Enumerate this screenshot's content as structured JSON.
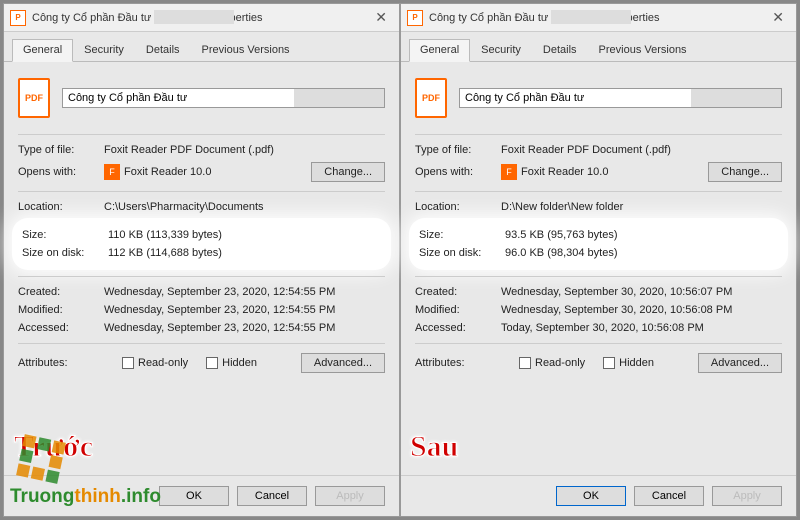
{
  "overlay": {
    "before": "Trước",
    "after": "Sau"
  },
  "watermark": {
    "text_a": "Truong",
    "text_b": "thinh",
    "text_c": ".info"
  },
  "left": {
    "title": "Công ty Cổ phần Đầu tư",
    "title_suffix": "Properties",
    "tabs": {
      "general": "General",
      "security": "Security",
      "details": "Details",
      "prev": "Previous Versions"
    },
    "filename": "Công ty Cổ phần Đầu tư",
    "labels": {
      "type": "Type of file:",
      "opens": "Opens with:",
      "location": "Location:",
      "size": "Size:",
      "sod": "Size on disk:",
      "created": "Created:",
      "modified": "Modified:",
      "accessed": "Accessed:",
      "attributes": "Attributes:",
      "readonly": "Read-only",
      "hidden": "Hidden"
    },
    "values": {
      "type": "Foxit Reader PDF Document (.pdf)",
      "opens": "Foxit Reader 10.0",
      "location": "C:\\Users\\Pharmacity\\Documents",
      "size": "110 KB (113,339 bytes)",
      "sod": "112 KB (114,688 bytes)",
      "created": "Wednesday, September 23, 2020, 12:54:55 PM",
      "modified": "Wednesday, September 23, 2020, 12:54:55 PM",
      "accessed": "Wednesday, September 23, 2020, 12:54:55 PM"
    },
    "buttons": {
      "change": "Change...",
      "advanced": "Advanced...",
      "ok": "OK",
      "cancel": "Cancel",
      "apply": "Apply"
    }
  },
  "right": {
    "title": "Công ty Cổ phần Đầu tư",
    "title_suffix": "Properties",
    "tabs": {
      "general": "General",
      "security": "Security",
      "details": "Details",
      "prev": "Previous Versions"
    },
    "filename": "Công ty Cổ phần Đầu tư",
    "labels": {
      "type": "Type of file:",
      "opens": "Opens with:",
      "location": "Location:",
      "size": "Size:",
      "sod": "Size on disk:",
      "created": "Created:",
      "modified": "Modified:",
      "accessed": "Accessed:",
      "attributes": "Attributes:",
      "readonly": "Read-only",
      "hidden": "Hidden"
    },
    "values": {
      "type": "Foxit Reader PDF Document (.pdf)",
      "opens": "Foxit Reader 10.0",
      "location": "D:\\New folder\\New folder",
      "size": "93.5 KB (95,763 bytes)",
      "sod": "96.0 KB (98,304 bytes)",
      "created": "Wednesday, September 30, 2020, 10:56:07 PM",
      "modified": "Wednesday, September 30, 2020, 10:56:08 PM",
      "accessed": "Today, September 30, 2020, 10:56:08 PM"
    },
    "buttons": {
      "change": "Change...",
      "advanced": "Advanced...",
      "ok": "OK",
      "cancel": "Cancel",
      "apply": "Apply"
    }
  }
}
